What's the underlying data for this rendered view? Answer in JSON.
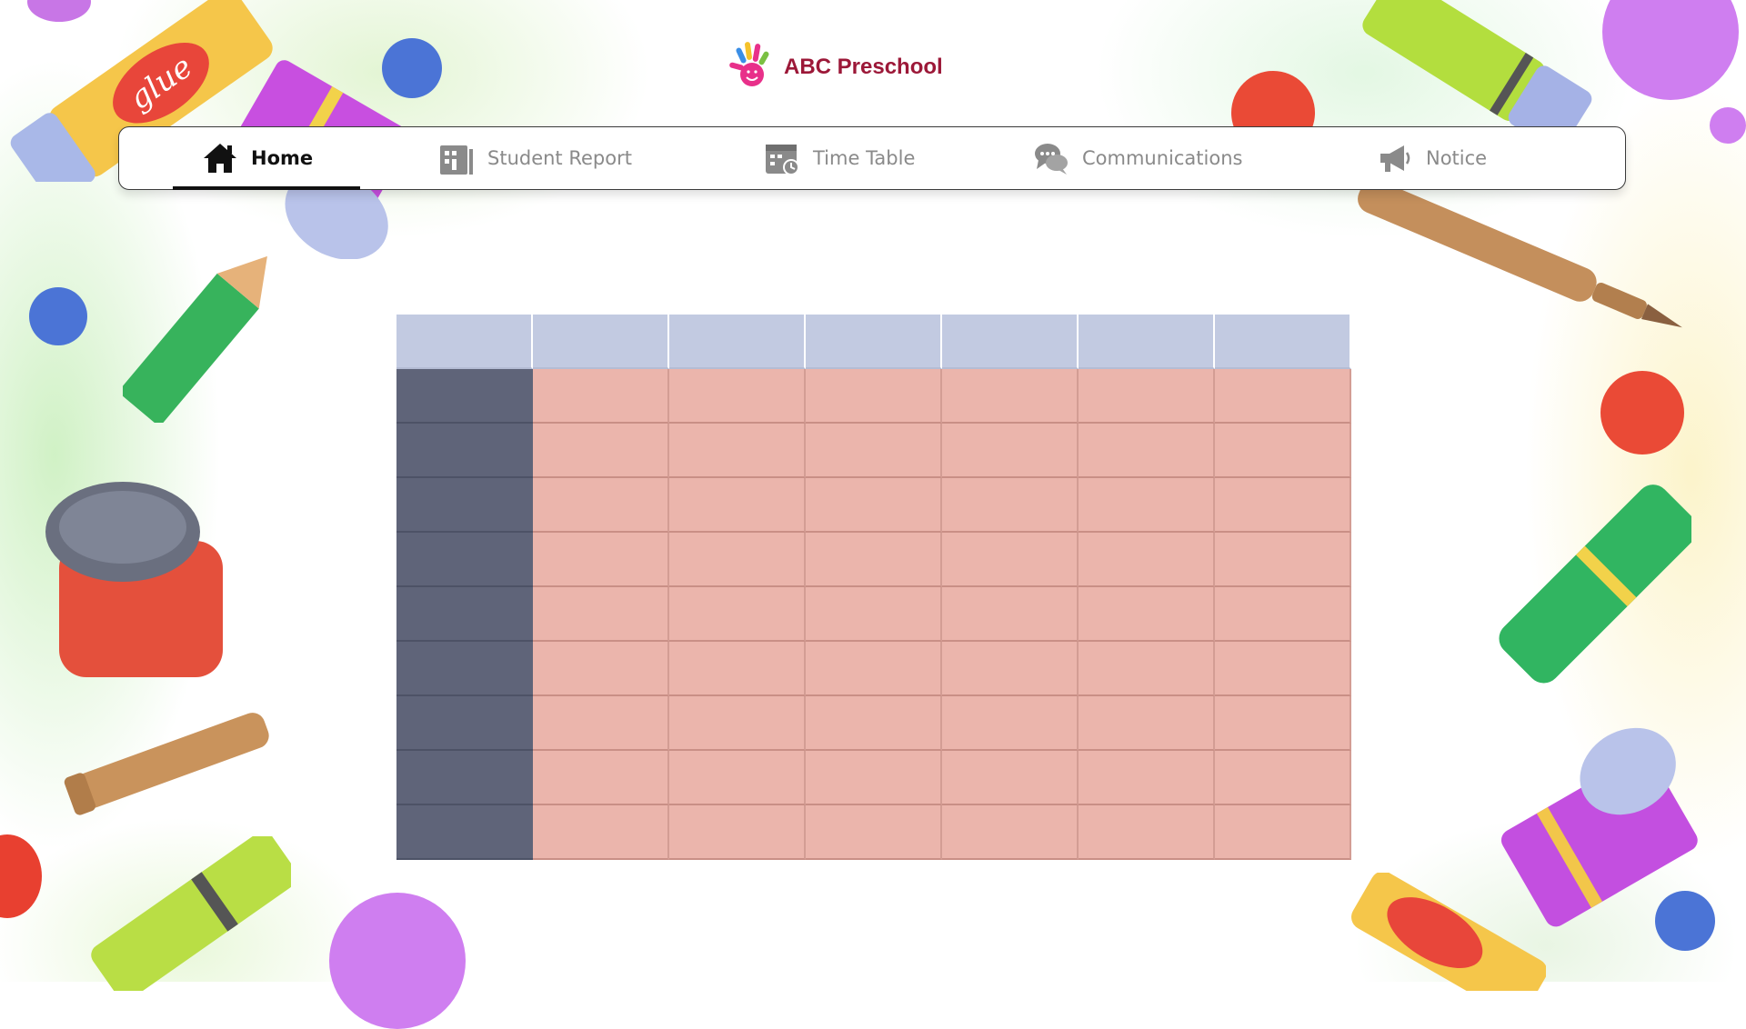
{
  "brand": {
    "name": "ABC Preschool",
    "logo_icon": "painted-hand-icon"
  },
  "nav": {
    "items": [
      {
        "label": "Home",
        "icon": "home-icon",
        "active": true
      },
      {
        "label": "Student Report",
        "icon": "report-icon",
        "active": false
      },
      {
        "label": "Time Table",
        "icon": "calendar-clock-icon",
        "active": false
      },
      {
        "label": "Communications",
        "icon": "chat-bubbles-icon",
        "active": false
      },
      {
        "label": "Notice",
        "icon": "megaphone-icon",
        "active": false
      }
    ]
  },
  "timetable": {
    "columns": 7,
    "body_rows": 9,
    "colors": {
      "header": "#c2cae1",
      "row_label": "#5f6479",
      "cell": "#ebb5ac"
    }
  },
  "colors": {
    "brand": "#9c1838",
    "nav_active": "#111111",
    "nav_inactive": "#8a8a8a"
  }
}
